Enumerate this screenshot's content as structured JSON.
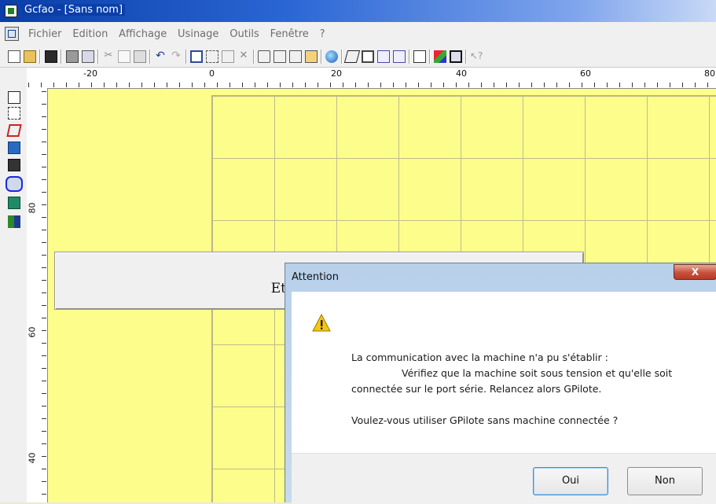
{
  "window": {
    "title": "Gcfao - [Sans nom]"
  },
  "menu": {
    "items": [
      "Fichier",
      "Edition",
      "Affichage",
      "Usinage",
      "Outils",
      "Fenêtre",
      "?"
    ]
  },
  "toolbar": {
    "icons": [
      "new-icon",
      "open-icon",
      "save-icon",
      "print-icon",
      "print-preview-icon",
      "cut-icon",
      "copy-icon",
      "paste-icon",
      "undo-icon",
      "redo-icon",
      "select-icon",
      "zoom-icon",
      "zoom-window-icon",
      "delete-icon",
      "zoom-in-icon",
      "zoom-out-icon",
      "zoom-all-icon",
      "zoom-extents-icon",
      "globe-icon",
      "3d-view-icon",
      "xy-view-icon",
      "xz-view-icon",
      "yz-view-icon",
      "window-icon",
      "cao-fao-icon",
      "fao-icon",
      "help-icon"
    ]
  },
  "ruler": {
    "h_labels": [
      "-20",
      "0",
      "20",
      "40",
      "60",
      "80"
    ],
    "v_labels": [
      "80",
      "60",
      "40"
    ]
  },
  "canvas": {
    "panel_text": "Etablissement"
  },
  "dialog": {
    "title": "Attention",
    "close_label": "X",
    "message_line1": "La communication avec la machine n'a pu s'établir :",
    "message_line2": "Vérifiez que la machine soit sous tension et qu'elle soit",
    "message_line3": "connectée sur le port série. Relancez alors GPilote.",
    "message_line4": "Voulez-vous utiliser GPilote sans machine connectée ?",
    "yes_label": "Oui",
    "no_label": "Non"
  },
  "colors": {
    "canvas_bg": "#fdfd8c",
    "title_bar": "#0a3ea8"
  }
}
